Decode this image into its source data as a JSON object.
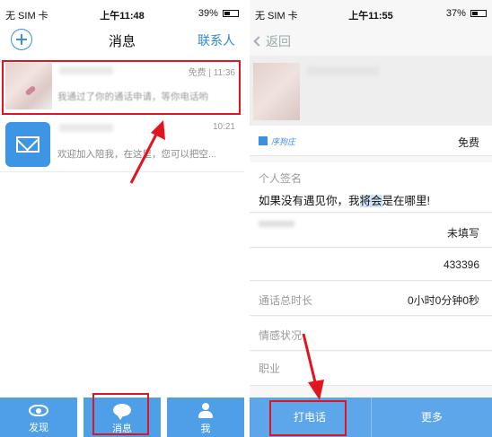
{
  "left": {
    "status": {
      "carrier": "无 SIM 卡",
      "time": "上午11:48",
      "battery": "39%"
    },
    "nav": {
      "title": "消息",
      "contacts": "联系人"
    },
    "messages": [
      {
        "time": "免费 | 11:36",
        "text": "我通过了你的通话申请，等你电话哟"
      },
      {
        "time": "10:21",
        "text": "欢迎加入陪我，在这里，您可以把空..."
      }
    ],
    "tabs": [
      {
        "label": "发现",
        "icon": "eye-icon"
      },
      {
        "label": "消息",
        "icon": "chat-icon"
      },
      {
        "label": "我",
        "icon": "person-icon"
      }
    ]
  },
  "right": {
    "status": {
      "carrier": "无 SIM 卡",
      "time": "上午11:55",
      "battery": "37%"
    },
    "back": "返回",
    "free_logo_text": "序狗庄",
    "free_label": "免费",
    "signature": {
      "label": "个人签名",
      "text_before": "如果没有遇见你，我",
      "text_selected": "将会",
      "text_after": "是在哪里!"
    },
    "rows": {
      "unfilled": "未填写",
      "number": "433396",
      "call_duration_label": "通话总时长",
      "call_duration_value": "0小时0分钟0秒",
      "emotion_label": "情感状况",
      "job_label": "职业"
    },
    "buttons": {
      "call": "打电话",
      "more": "更多"
    }
  },
  "colors": {
    "accent": "#4f9fe8",
    "highlight": "#e0151f"
  }
}
